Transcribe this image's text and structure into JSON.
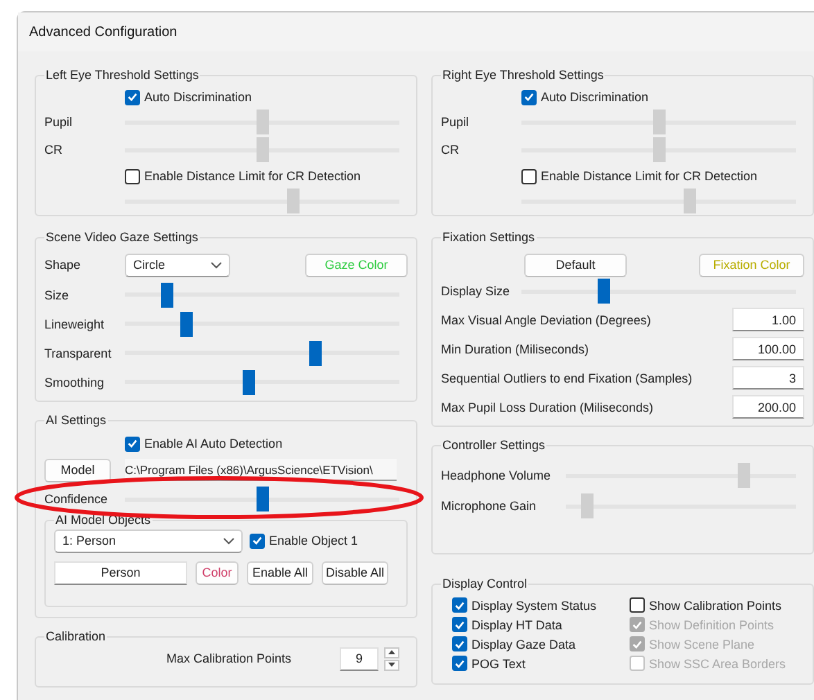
{
  "window": {
    "title": "Advanced Configuration"
  },
  "left_eye": {
    "title": "Left Eye Threshold Settings",
    "auto_discrimination": {
      "label": "Auto Discrimination",
      "checked": true
    },
    "sliders": [
      {
        "label": "Pupil",
        "level": 0.5,
        "disabled": true
      },
      {
        "label": "CR",
        "level": 0.5,
        "disabled": true
      }
    ],
    "distance_limit": {
      "label": "Enable Distance Limit for CR Detection",
      "checked": false
    },
    "distance_slider": {
      "level": 0.61,
      "disabled": true
    }
  },
  "right_eye": {
    "title": "Right Eye Threshold Settings",
    "auto_discrimination": {
      "label": "Auto Discrimination",
      "checked": true
    },
    "sliders": [
      {
        "label": "Pupil",
        "level": 0.5,
        "disabled": true
      },
      {
        "label": "CR",
        "level": 0.5,
        "disabled": true
      }
    ],
    "distance_limit": {
      "label": "Enable Distance Limit for CR Detection",
      "checked": false
    },
    "distance_slider": {
      "level": 0.61,
      "disabled": true
    }
  },
  "scene_gaze": {
    "title": "Scene Video Gaze Settings",
    "shape_label": "Shape",
    "shape_value": "Circle",
    "color_button": "Gaze Color",
    "sliders": [
      {
        "label": "Size",
        "level": 0.15,
        "disabled": false
      },
      {
        "label": "Lineweight",
        "level": 0.22,
        "disabled": false
      },
      {
        "label": "Transparent",
        "level": 0.69,
        "disabled": false
      },
      {
        "label": "Smoothing",
        "level": 0.45,
        "disabled": false
      }
    ]
  },
  "ai_settings": {
    "title": "AI Settings",
    "enable": {
      "label": "Enable AI Auto Detection",
      "checked": true
    },
    "model_button": "Model",
    "model_path": "C:\\Program Files (x86)\\ArgusScience\\ETVision\\",
    "confidence": {
      "label": "Confidence",
      "level": 0.5,
      "disabled": false
    },
    "objects": {
      "title": "AI Model Objects",
      "select_value": "1: Person",
      "enable_object": {
        "label": "Enable Object 1",
        "checked": true
      },
      "name_value": "Person",
      "color_button": "Color",
      "enable_all_button": "Enable All",
      "disable_all_button": "Disable All"
    }
  },
  "calibration": {
    "title": "Calibration",
    "label": "Max Calibration Points",
    "value": "9"
  },
  "fixation": {
    "title": "Fixation Settings",
    "default_button": "Default",
    "color_button": "Fixation Color",
    "display_size": {
      "label": "Display Size",
      "level": 0.3,
      "disabled": false
    },
    "fields": [
      {
        "label": "Max Visual Angle Deviation (Degrees)",
        "value": "1.00"
      },
      {
        "label": "Min Duration (Miliseconds)",
        "value": "100.00"
      },
      {
        "label": "Sequential Outliers to end Fixation (Samples)",
        "value": "3"
      },
      {
        "label": "Max Pupil Loss Duration (Miliseconds)",
        "value": "200.00"
      }
    ]
  },
  "controller": {
    "title": "Controller Settings",
    "sliders": [
      {
        "label": "Headphone Volume",
        "level": 0.77,
        "disabled": true
      },
      {
        "label": "Microphone Gain",
        "level": 0.09,
        "disabled": true
      }
    ]
  },
  "display_control": {
    "title": "Display Control",
    "columns": [
      [
        {
          "label": "Display System Status",
          "checked": true,
          "disabled": false
        },
        {
          "label": "Display HT Data",
          "checked": true,
          "disabled": false
        },
        {
          "label": "Display Gaze Data",
          "checked": true,
          "disabled": false
        },
        {
          "label": "POG Text",
          "checked": true,
          "disabled": false
        }
      ],
      [
        {
          "label": "Show Calibration Points",
          "checked": false,
          "disabled": false
        },
        {
          "label": "Show Definition Points",
          "checked": true,
          "disabled": true
        },
        {
          "label": "Show Scene Plane",
          "checked": true,
          "disabled": true
        },
        {
          "label": "Show SSC Area Borders",
          "checked": false,
          "disabled": true
        }
      ]
    ]
  }
}
